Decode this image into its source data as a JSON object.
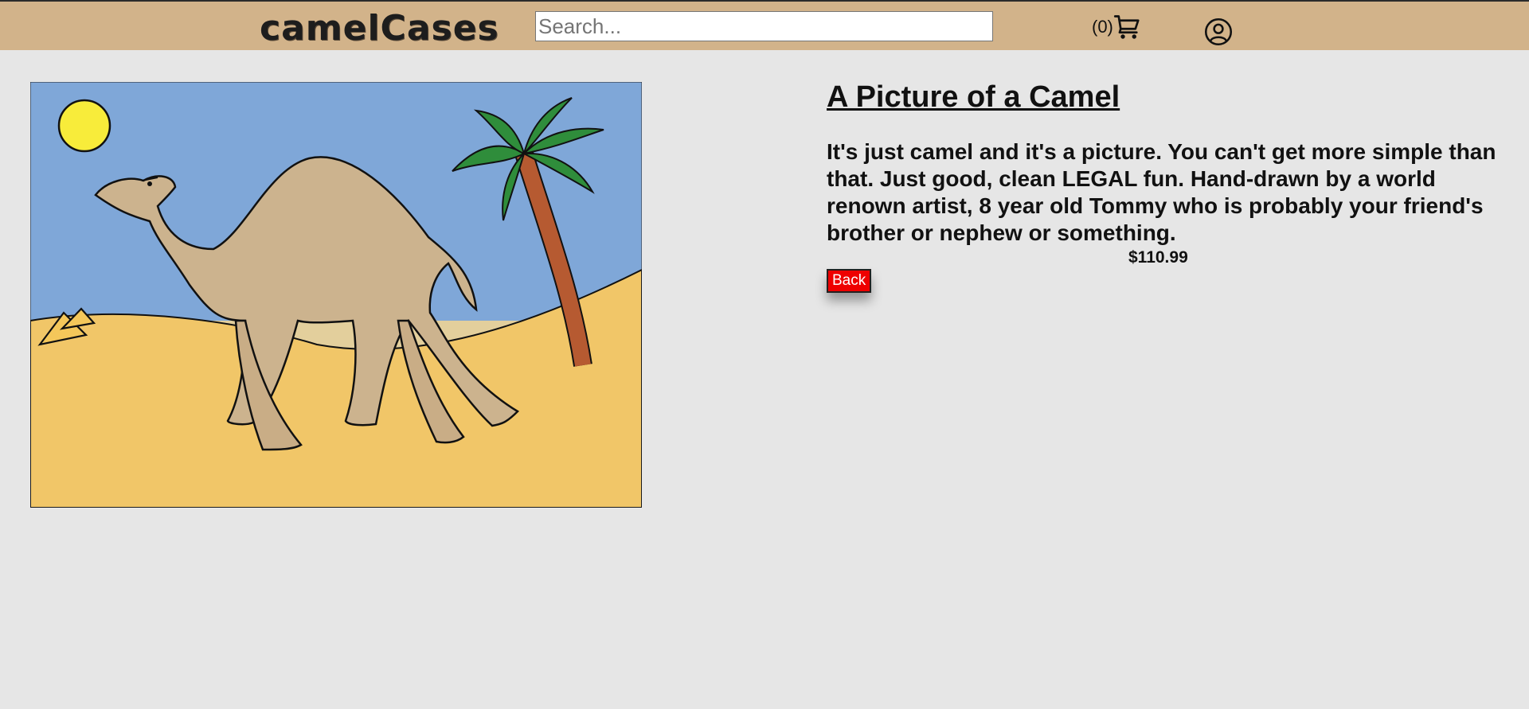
{
  "header": {
    "logo_text": "camelCases",
    "search_placeholder": "Search...",
    "search_value": "",
    "cart_count": "(0)",
    "cart_icon": "shopping-cart-icon",
    "account_icon": "user-circle-icon",
    "background_color": "#d2b38a"
  },
  "product": {
    "title": "A Picture of a Camel",
    "description": "It's just camel and it's a picture. You can't get more simple than that. Just good, clean LEGAL fun. Hand-drawn by a world renown artist, 8 year old Tommy who is probably your friend's brother or nephew or something.",
    "price": "$110.99",
    "back_label": "Back",
    "back_color": "#ee0000"
  }
}
